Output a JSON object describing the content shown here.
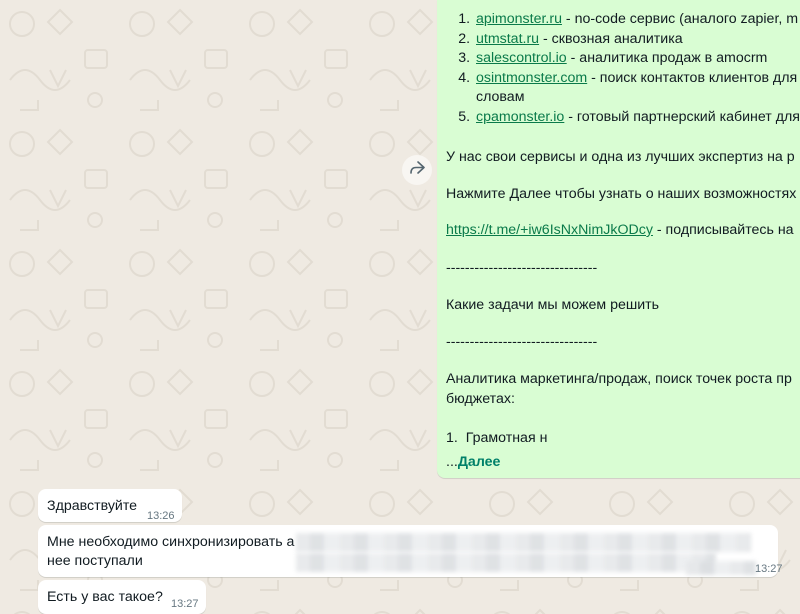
{
  "outgoing": {
    "services": [
      {
        "link": "apimonster.ru",
        "desc": " - no-code сервис (аналого zapier, m"
      },
      {
        "link": "utmstat.ru",
        "desc": " - сквозная аналитика"
      },
      {
        "link": "salescontrol.io",
        "desc": " - аналитика продаж в amocrm"
      },
      {
        "link": "osintmonster.com",
        "desc": " - поиск контактов клиентов для",
        "desc2": "словам"
      },
      {
        "link": "cpamonster.io",
        "desc": " - готовый партнерский кабинет для"
      }
    ],
    "p_expertise": "У нас свои сервисы и одна из лучших экспертиз на р",
    "p_next": "Нажмите Далее чтобы узнать о наших возможностях",
    "tg_link": "https://t.me/+iw6IsNxNimJkODcy",
    "tg_suffix": " - подписывайтесь на",
    "divider1": "--------------------------------",
    "tasks_heading": "Какие задачи мы можем решить",
    "divider2": "--------------------------------",
    "analytics_line1": "Аналитика маркетинга/продаж, поиск точек роста пр",
    "analytics_line2": "бюджетах:",
    "list_item": "Грамотная н",
    "more_prefix": "...",
    "more_label": "Далее"
  },
  "incoming": [
    {
      "text": "Здравствуйте",
      "time": "13:26"
    },
    {
      "text": "Мне необходимо синхронизировать а",
      "text2": "нее поступали",
      "time": "13:27"
    },
    {
      "text": "Есть у вас такое?",
      "time": "13:27"
    }
  ],
  "colors": {
    "background": "#efeae2",
    "outgoing_bubble": "#d9fdd3",
    "incoming_bubble": "#ffffff",
    "accent": "#008069"
  },
  "icons": {
    "forward": "forward-icon"
  }
}
